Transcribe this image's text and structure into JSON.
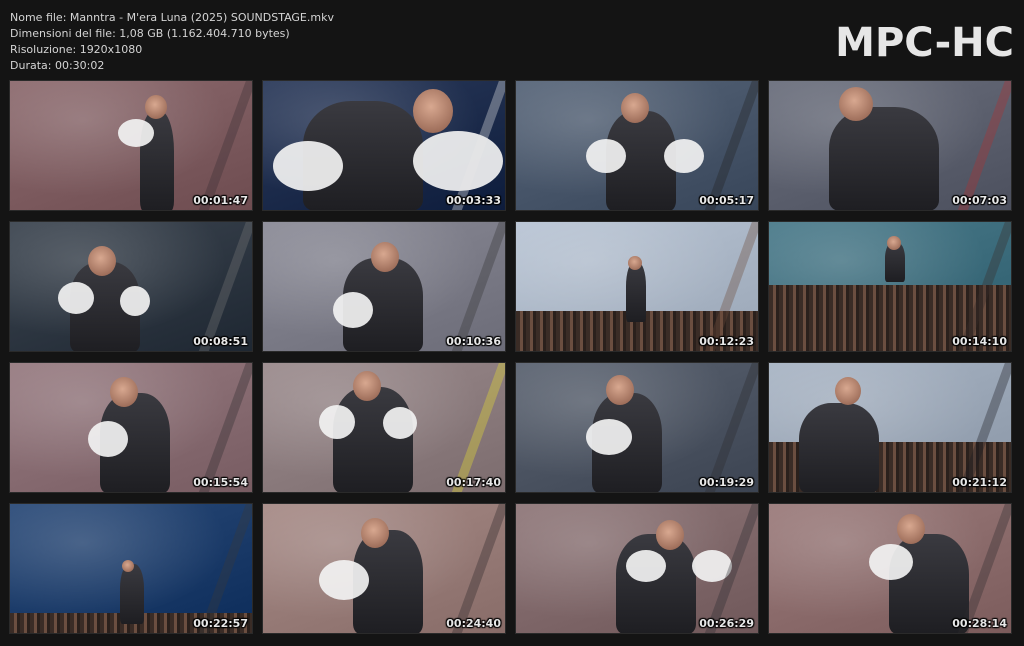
{
  "info": {
    "filename": "Nome file: Manntra - M'era Luna (2025) SOUNDSTAGE.mkv",
    "filesize": "Dimensioni del file: 1,08 GB (1.162.404.710 bytes)",
    "resolution": "Risoluzione: 1920x1080",
    "duration": "Durata: 00:30:02"
  },
  "logo": "MPC-HC",
  "thumbnails": [
    {
      "time": "00:01:47",
      "bg": "#8c6a6e",
      "accent": "#3a2f33"
    },
    {
      "time": "00:03:33",
      "bg": "#2b3a5a",
      "accent": "#e8e8e8"
    },
    {
      "time": "00:05:17",
      "bg": "#566478",
      "accent": "#222"
    },
    {
      "time": "00:07:03",
      "bg": "#6a6e7c",
      "accent": "#b03030"
    },
    {
      "time": "00:08:51",
      "bg": "#3c4550",
      "accent": "#777"
    },
    {
      "time": "00:10:36",
      "bg": "#8a8a96",
      "accent": "#333"
    },
    {
      "time": "00:12:23",
      "bg": "#b8c4d4",
      "accent": "#6e4a3a"
    },
    {
      "time": "00:14:10",
      "bg": "#4a7a8a",
      "accent": "#3a2e2a"
    },
    {
      "time": "00:15:54",
      "bg": "#967a80",
      "accent": "#2e2a2e"
    },
    {
      "time": "00:17:40",
      "bg": "#9a8a8c",
      "accent": "#e8e030"
    },
    {
      "time": "00:19:29",
      "bg": "#5a6270",
      "accent": "#2a2a2e"
    },
    {
      "time": "00:21:12",
      "bg": "#a8b4c4",
      "accent": "#1e1e22"
    },
    {
      "time": "00:22:57",
      "bg": "#2a4a78",
      "accent": "#3a3a3a"
    },
    {
      "time": "00:24:40",
      "bg": "#a68a86",
      "accent": "#2a2428"
    },
    {
      "time": "00:26:29",
      "bg": "#8e7678",
      "accent": "#2a2a30"
    },
    {
      "time": "00:28:14",
      "bg": "#9a7a7a",
      "accent": "#2e2a2e"
    }
  ]
}
